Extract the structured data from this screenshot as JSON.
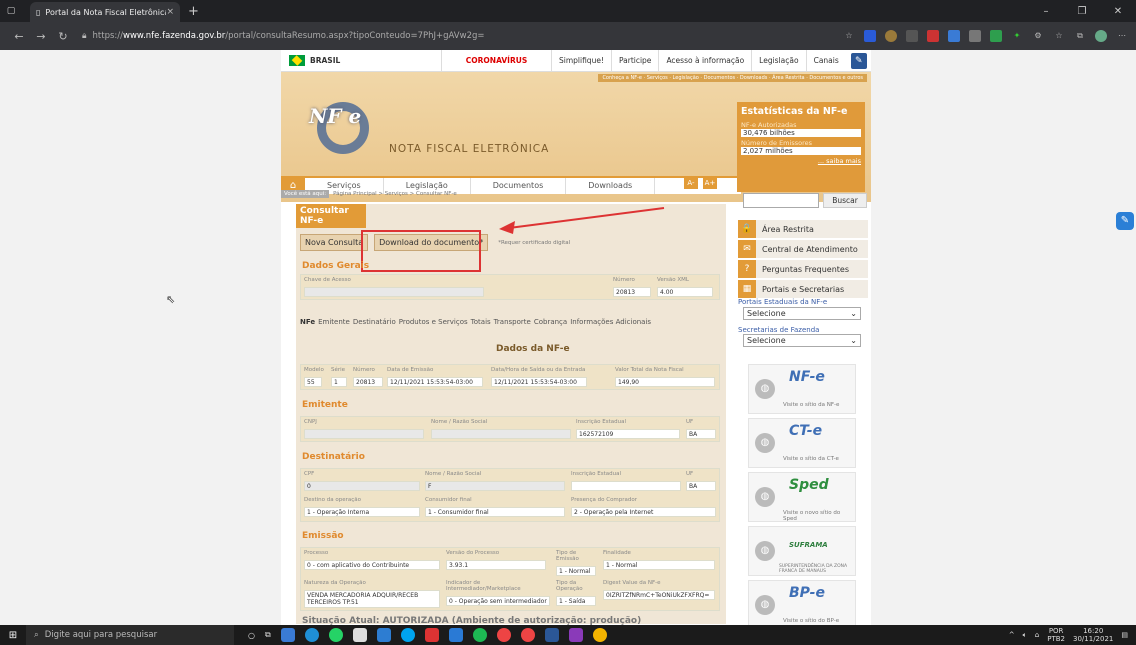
{
  "browser": {
    "tab_title": "Portal da Nota Fiscal Eletrônica",
    "url_prefix": "https://",
    "url_host": "www.nfe.fazenda.gov.br",
    "url_path": "/portal/consultaResumo.aspx?tipoConteudo=7PhJ+gAVw2g=",
    "new_tab": "+",
    "close": "×"
  },
  "govbar": {
    "brasil": "BRASIL",
    "items": [
      "CORONAVÍRUS (COVID-19)",
      "Simplifique!",
      "Participe",
      "Acesso à informação",
      "Legislação",
      "Canais"
    ]
  },
  "banner": {
    "top_links": "Conheça a NF-e · Serviços · Legislação · Documentos · Downloads · Área Restrita · Documentos e outros",
    "logo_text": "NF e",
    "title": "NOTA FISCAL ELETRÔNICA",
    "nav": [
      "Serviços",
      "Legislação",
      "Documentos",
      "Downloads"
    ],
    "home_icon": "⌂"
  },
  "stats": {
    "title": "Estatísticas da NF-e",
    "label1": "NF-e Autorizadas",
    "value1": "30,476 bilhões",
    "label2": "Número de Emissores",
    "value2": "2,027 milhões",
    "more": "... saiba mais"
  },
  "breadcrumb": {
    "here": "Você está aqui:",
    "path": "Página Principal > Serviços > Consultar NF-e"
  },
  "font_buttons": [
    "A-",
    "A+"
  ],
  "search": {
    "button": "Buscar"
  },
  "main": {
    "section_title": "Consultar NF-e",
    "btn_new": "Nova Consulta",
    "btn_download": "Download do documento*",
    "cert_note": "*Requer certificado digital",
    "dados_gerais": "Dados Gerais",
    "chave_label": "Chave de Acesso",
    "numero_label": "Número",
    "numero": "20813",
    "versao_label": "Versão XML",
    "versao": "4.00",
    "tabs": [
      "NFe",
      "Emitente",
      "Destinatário",
      "Produtos e Serviços",
      "Totais",
      "Transporte",
      "Cobrança",
      "Informações Adicionais"
    ],
    "dados_nfe": "Dados da NF-e",
    "nfe_fields": {
      "modelo_label": "Modelo",
      "modelo": "55",
      "serie_label": "Série",
      "serie": "1",
      "numero_label": "Número",
      "numero": "20813",
      "emissao_label": "Data de Emissão",
      "emissao": "12/11/2021 15:53:54-03:00",
      "saida_label": "Data/Hora de Saída ou da Entrada",
      "saida": "12/11/2021 15:53:54-03:00",
      "valor_label": "Valor Total da Nota Fiscal",
      "valor": "149,90"
    },
    "emitente": "Emitente",
    "emit_fields": {
      "cnpj_label": "CNPJ",
      "nome_label": "Nome / Razão Social",
      "ie_label": "Inscrição Estadual",
      "ie": "162572109",
      "uf_label": "UF",
      "uf": "BA"
    },
    "destinatario": "Destinatário",
    "dest_fields": {
      "cpf_label": "CPF",
      "cpf": "0",
      "nome_label": "Nome / Razão Social",
      "nome": "F",
      "ie_label": "Inscrição Estadual",
      "uf_label": "UF",
      "uf": "BA",
      "destino_label": "Destino da operação",
      "destino": "1 - Operação Interna",
      "consumidor_label": "Consumidor final",
      "consumidor": "1 - Consumidor final",
      "presenca_label": "Presença do Comprador",
      "presenca": "2 - Operação pela Internet"
    },
    "emissao": "Emissão",
    "emis_fields": {
      "processo_label": "Processo",
      "processo": "0 - com aplicativo do Contribuinte",
      "versao_label": "Versão do Processo",
      "versao": "3.93.1",
      "tipo_emis_label": "Tipo de Emissão",
      "tipo_emis": "1 - Normal",
      "finalidade_label": "Finalidade",
      "finalidade": "1 - Normal",
      "natureza_label": "Natureza da Operação",
      "natureza": "VENDA MERCADORIA ADQUIR/RECEB TERCEIROS TP.51",
      "indicador_label": "Indicador de Intermediador/Marketplace",
      "indicador": "0 - Operação sem intermediador",
      "tipo_op_label": "Tipo da Operação",
      "tipo_op": "1 - Saída",
      "digest_label": "Digest Value da NF-e",
      "digest": "0IZRITZfNRmC+TeONiUkZFXFRQ="
    },
    "situacao": "Situação Atual: AUTORIZADA (Ambiente de autorização: produção)"
  },
  "sidebar": {
    "links": [
      "Área Restrita",
      "Central de Atendimento",
      "Perguntas Frequentes",
      "Portais e Secretarias"
    ],
    "link_icons": [
      "🔒",
      "✉",
      "?",
      "▦"
    ],
    "portais_label": "Portais Estaduais da NF-e",
    "portais_value": "Selecione",
    "secretarias_label": "Secretarias de Fazenda",
    "secretarias_value": "Selecione",
    "promos": [
      {
        "logo": "NF-e",
        "text": "Visite o sítio da NF-e"
      },
      {
        "logo": "CT-e",
        "text": "Visite o sítio da CT-e"
      },
      {
        "logo": "Sped",
        "text": "Visite o novo sítio do Sped"
      },
      {
        "logo": "SUFRAMA",
        "text": "SUPERINTENDÊNCIA DA ZONA FRANCA DE MANAUS"
      },
      {
        "logo": "BP-e",
        "text": "Visite o sítio do BP-e"
      }
    ]
  },
  "taskbar": {
    "search": "Digite aqui para pesquisar",
    "lang": "POR",
    "lang2": "PTB2",
    "time": "16:20",
    "date": "30/11/2021"
  },
  "colors": {
    "accent": "#e29b37",
    "highlight": "#d33333"
  }
}
